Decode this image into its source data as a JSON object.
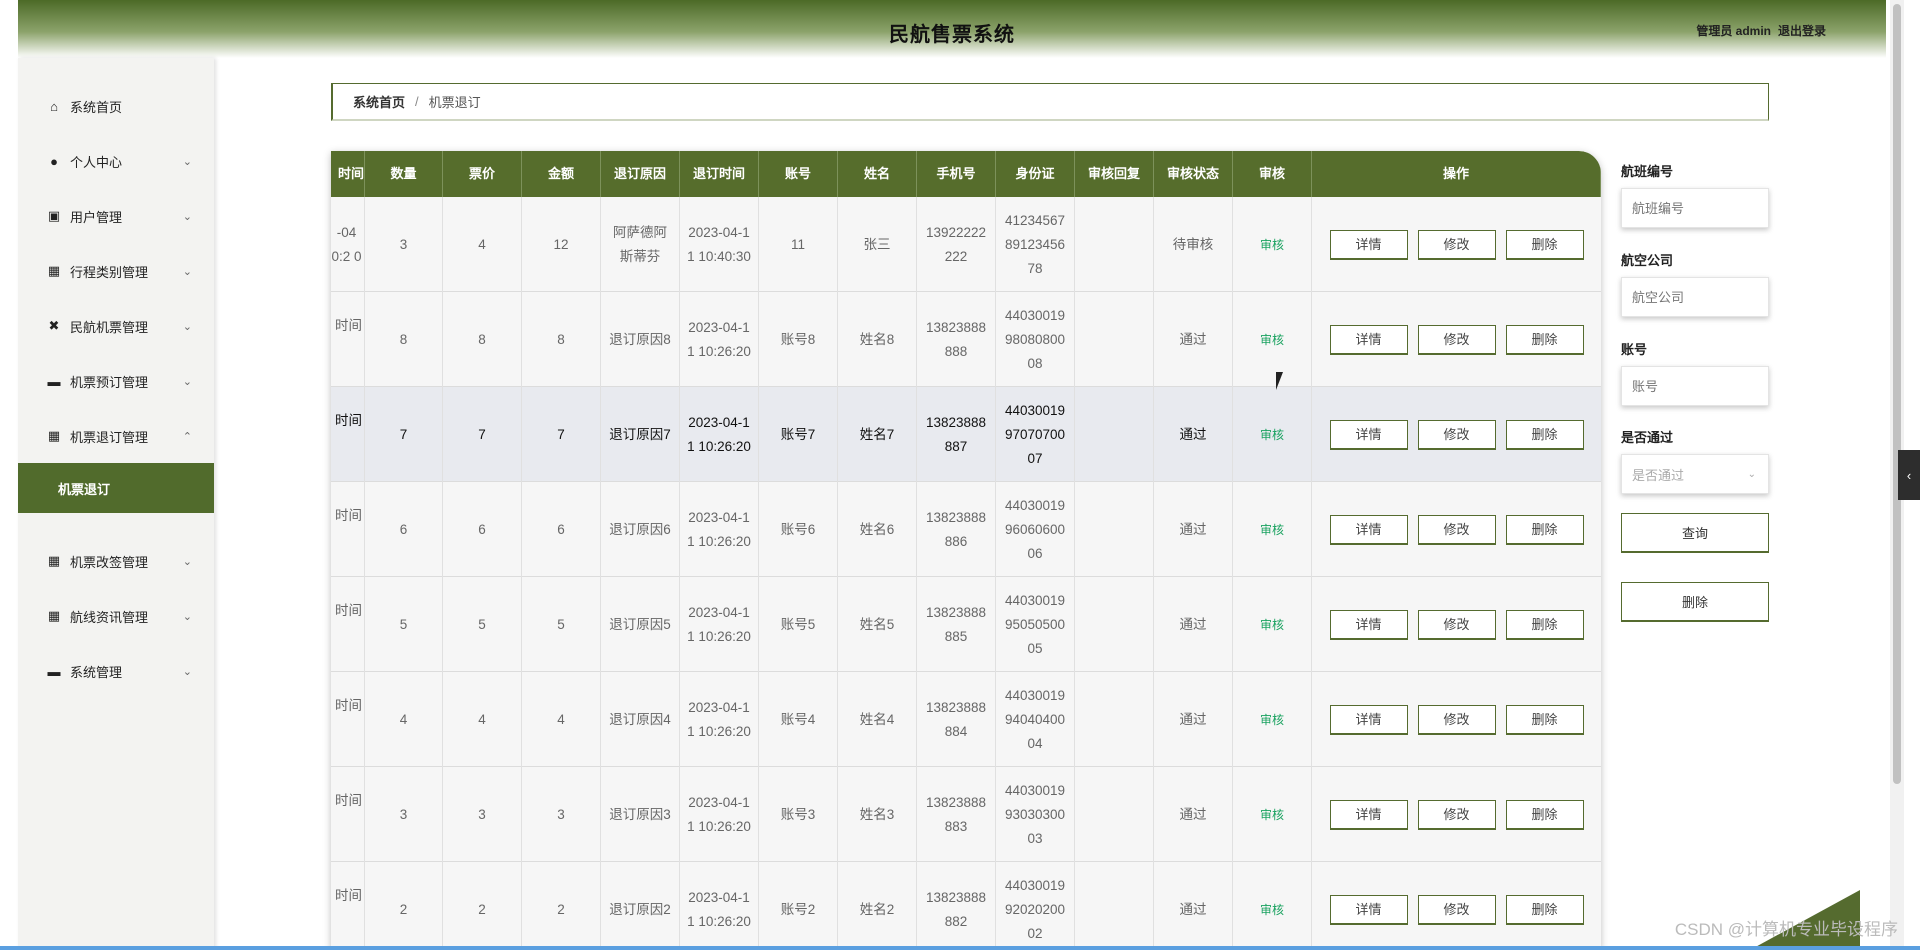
{
  "header": {
    "title": "民航售票系统",
    "user": "管理员 admin",
    "logout": "退出登录"
  },
  "sidebar": {
    "items": [
      {
        "label": "系统首页",
        "icon": "home-icon",
        "glyph": "⌂",
        "arrow": ""
      },
      {
        "label": "个人中心",
        "icon": "user-icon",
        "glyph": "●",
        "arrow": "⌄"
      },
      {
        "label": "用户管理",
        "icon": "clipboard-icon",
        "glyph": "▣",
        "arrow": "⌄"
      },
      {
        "label": "行程类别管理",
        "icon": "grid-icon",
        "glyph": "▦",
        "arrow": "⌄"
      },
      {
        "label": "民航机票管理",
        "icon": "ticket-icon",
        "glyph": "✖",
        "arrow": "⌄"
      },
      {
        "label": "机票预订管理",
        "icon": "briefcase-icon",
        "glyph": "▬",
        "arrow": "⌄"
      },
      {
        "label": "机票退订管理",
        "icon": "grid-icon",
        "glyph": "▦",
        "arrow": "⌃"
      },
      {
        "label": "机票改签管理",
        "icon": "grid-icon",
        "glyph": "▦",
        "arrow": "⌄"
      },
      {
        "label": "航线资讯管理",
        "icon": "apps-icon",
        "glyph": "▦",
        "arrow": "⌄"
      },
      {
        "label": "系统管理",
        "icon": "message-icon",
        "glyph": "▬",
        "arrow": "⌄"
      }
    ],
    "active_sub": "机票退订"
  },
  "breadcrumb": {
    "home": "系统首页",
    "sep": "/",
    "current": "机票退订"
  },
  "table": {
    "headers": [
      "时间",
      "数量",
      "票价",
      "金额",
      "退订原因",
      "退订时间",
      "账号",
      "姓名",
      "手机号",
      "身份证",
      "审核回复",
      "审核状态",
      "审核",
      "操作"
    ],
    "audit_label": "审核",
    "btn_detail": "详情",
    "btn_edit": "修改",
    "btn_delete": "删除",
    "rows": [
      {
        "time": "-04 0:2 0",
        "qty": "3",
        "price": "4",
        "amount": "12",
        "reason": "阿萨德阿斯蒂芬",
        "rtime": "2023-04-11 10:40:30",
        "account": "11",
        "name": "张三",
        "phone": "13922222222",
        "idcard": "412345678912345678",
        "reply": "",
        "status": "待审核"
      },
      {
        "time": "时间",
        "qty": "8",
        "price": "8",
        "amount": "8",
        "reason": "退订原因8",
        "rtime": "2023-04-11 10:26:20",
        "account": "账号8",
        "name": "姓名8",
        "phone": "13823888888",
        "idcard": "440300199808080008",
        "reply": "",
        "status": "通过"
      },
      {
        "time": "时间",
        "qty": "7",
        "price": "7",
        "amount": "7",
        "reason": "退订原因7",
        "rtime": "2023-04-11 10:26:20",
        "account": "账号7",
        "name": "姓名7",
        "phone": "13823888887",
        "idcard": "440300199707070007",
        "reply": "",
        "status": "通过"
      },
      {
        "time": "时间",
        "qty": "6",
        "price": "6",
        "amount": "6",
        "reason": "退订原因6",
        "rtime": "2023-04-11 10:26:20",
        "account": "账号6",
        "name": "姓名6",
        "phone": "13823888886",
        "idcard": "440300199606060006",
        "reply": "",
        "status": "通过"
      },
      {
        "time": "时间",
        "qty": "5",
        "price": "5",
        "amount": "5",
        "reason": "退订原因5",
        "rtime": "2023-04-11 10:26:20",
        "account": "账号5",
        "name": "姓名5",
        "phone": "13823888885",
        "idcard": "440300199505050005",
        "reply": "",
        "status": "通过"
      },
      {
        "time": "时间",
        "qty": "4",
        "price": "4",
        "amount": "4",
        "reason": "退订原因4",
        "rtime": "2023-04-11 10:26:20",
        "account": "账号4",
        "name": "姓名4",
        "phone": "13823888884",
        "idcard": "440300199404040004",
        "reply": "",
        "status": "通过"
      },
      {
        "time": "时间",
        "qty": "3",
        "price": "3",
        "amount": "3",
        "reason": "退订原因3",
        "rtime": "2023-04-11 10:26:20",
        "account": "账号3",
        "name": "姓名3",
        "phone": "13823888883",
        "idcard": "440300199303030003",
        "reply": "",
        "status": "通过"
      },
      {
        "time": "时间",
        "qty": "2",
        "price": "2",
        "amount": "2",
        "reason": "退订原因2",
        "rtime": "2023-04-11 10:26:20",
        "account": "账号2",
        "name": "姓名2",
        "phone": "13823888882",
        "idcard": "440300199202020002",
        "reply": "",
        "status": "通过"
      }
    ]
  },
  "search": {
    "flight_label": "航班编号",
    "flight_placeholder": "航班编号",
    "airline_label": "航空公司",
    "airline_placeholder": "航空公司",
    "account_label": "账号",
    "account_placeholder": "账号",
    "pass_label": "是否通过",
    "pass_placeholder": "是否通过",
    "query_btn": "查询",
    "delete_btn": "删除"
  },
  "watermark": "CSDN @计算机专业毕设程序",
  "colors": {
    "primary": "#556b2f",
    "audit_link": "#1aa260"
  }
}
